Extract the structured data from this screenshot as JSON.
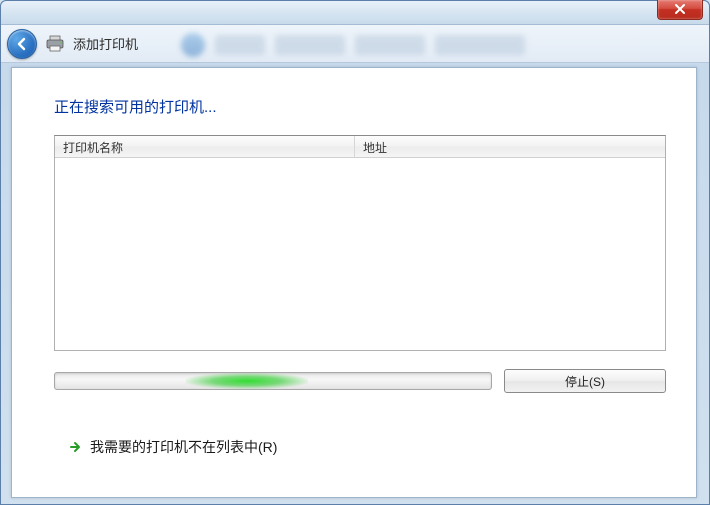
{
  "window": {
    "title": "添加打印机"
  },
  "dialog": {
    "heading": "正在搜索可用的打印机...",
    "columns": {
      "name": "打印机名称",
      "address": "地址"
    },
    "stop_label": "停止(S)",
    "not_listed_label": "我需要的打印机不在列表中(R)"
  },
  "icons": {
    "back": "back-arrow",
    "printer": "printer",
    "close": "close-x",
    "link_arrow": "right-arrow"
  }
}
